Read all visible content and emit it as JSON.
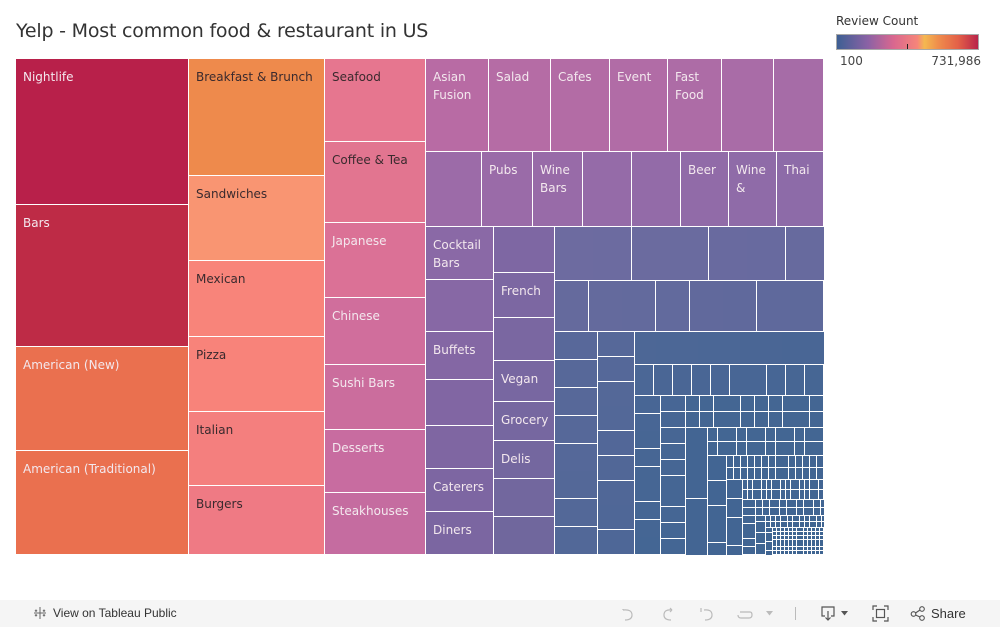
{
  "title": "Yelp - Most common food & restaurant in US",
  "legend": {
    "title": "Review Count",
    "min_label": "100",
    "max_label": "731,986",
    "colors": [
      "#3d5f93",
      "#8b62a5",
      "#d9678f",
      "#f6857a",
      "#f4b850",
      "#ef8c4c",
      "#e36048",
      "#b8244a"
    ]
  },
  "chart_data": {
    "type": "treemap",
    "title": "Yelp - Most common food & restaurant in US",
    "size_measure": "Review Count",
    "color_measure": "Review Count",
    "color_range": [
      100,
      731986
    ],
    "labeled_categories": [
      "Nightlife",
      "Bars",
      "American (New)",
      "American (Traditional)",
      "Breakfast & Brunch",
      "Sandwiches",
      "Mexican",
      "Pizza",
      "Italian",
      "Burgers",
      "Seafood",
      "Coffee & Tea",
      "Japanese",
      "Chinese",
      "Sushi Bars",
      "Desserts",
      "Steakhouses",
      "Asian Fusion",
      "Salad",
      "Cafes",
      "Event",
      "Fast Food",
      "Pubs",
      "Wine Bars",
      "Beer",
      "Wine &",
      "Thai",
      "Cocktail Bars",
      "French",
      "Buffets",
      "Vegan",
      "Grocery",
      "Delis",
      "Caterers",
      "Diners"
    ],
    "tiles": [
      {
        "label": "Nightlife",
        "color": "#b8204a",
        "text": "light",
        "area": [
          0,
          0,
          173,
          146
        ]
      },
      {
        "label": "Bars",
        "color": "#be2b46",
        "text": "light",
        "area": [
          0,
          146,
          173,
          142
        ]
      },
      {
        "label": "American (New)",
        "color": "#ea704f",
        "text": "light",
        "area": [
          0,
          288,
          173,
          104
        ]
      },
      {
        "label": "American (Traditional)",
        "color": "#ea704f",
        "text": "light",
        "area": [
          0,
          392,
          173,
          104
        ]
      },
      {
        "label": "Breakfast & Brunch",
        "color": "#ee8a4c",
        "text": "dark",
        "area": [
          173,
          0,
          136,
          117
        ]
      },
      {
        "label": "Sandwiches",
        "color": "#f99572",
        "text": "dark",
        "area": [
          173,
          117,
          136,
          85
        ]
      },
      {
        "label": "Mexican",
        "color": "#f8847a",
        "text": "dark",
        "area": [
          173,
          202,
          136,
          76
        ]
      },
      {
        "label": "Pizza",
        "color": "#f8837a",
        "text": "dark",
        "area": [
          173,
          278,
          136,
          75
        ]
      },
      {
        "label": "Italian",
        "color": "#f47f7e",
        "text": "dark",
        "area": [
          173,
          353,
          136,
          74
        ]
      },
      {
        "label": "Burgers",
        "color": "#ef7a84",
        "text": "dark",
        "area": [
          173,
          427,
          136,
          69
        ]
      },
      {
        "label": "Seafood",
        "color": "#e6768f",
        "text": "dark",
        "area": [
          309,
          0,
          101,
          83
        ]
      },
      {
        "label": "Coffee & Tea",
        "color": "#e27590",
        "text": "dark",
        "area": [
          309,
          83,
          101,
          81
        ]
      },
      {
        "label": "Japanese",
        "color": "#db7196",
        "text": "light",
        "area": [
          309,
          164,
          101,
          75
        ]
      },
      {
        "label": "Chinese",
        "color": "#d06e9c",
        "text": "light",
        "area": [
          309,
          239,
          101,
          67
        ]
      },
      {
        "label": "Sushi Bars",
        "color": "#cb6d9d",
        "text": "light",
        "area": [
          309,
          306,
          101,
          65
        ]
      },
      {
        "label": "Desserts",
        "color": "#c86ca0",
        "text": "light",
        "area": [
          309,
          371,
          101,
          63
        ]
      },
      {
        "label": "Steakhouses",
        "color": "#c56ca0",
        "text": "light",
        "area": [
          309,
          434,
          101,
          62
        ]
      },
      {
        "label": "Asian Fusion",
        "color": "#b86ba4",
        "text": "light",
        "area": [
          410,
          0,
          63,
          93
        ]
      },
      {
        "label": "Salad",
        "color": "#b56ca5",
        "text": "light",
        "area": [
          473,
          0,
          62,
          93
        ]
      },
      {
        "label": "Cafes",
        "color": "#b36ca5",
        "text": "light",
        "area": [
          535,
          0,
          59,
          93
        ]
      },
      {
        "label": "Event",
        "color": "#b16ca6",
        "text": "light",
        "area": [
          594,
          0,
          58,
          93
        ]
      },
      {
        "label": "Fast Food",
        "color": "#ad6ca6",
        "text": "light",
        "area": [
          652,
          0,
          54,
          93
        ]
      },
      {
        "label": "",
        "color": "#a96ca7",
        "text": "light",
        "area": [
          706,
          0,
          52,
          93
        ]
      },
      {
        "label": "",
        "color": "#a66ca7",
        "text": "light",
        "area": [
          758,
          0,
          50,
          93
        ]
      },
      {
        "label": "",
        "color": "#9c6ba8",
        "text": "light",
        "area": [
          410,
          93,
          56,
          75
        ]
      },
      {
        "label": "Pubs",
        "color": "#9a6ba8",
        "text": "light",
        "area": [
          466,
          93,
          51,
          75
        ]
      },
      {
        "label": "Wine Bars",
        "color": "#986ba8",
        "text": "light",
        "area": [
          517,
          93,
          50,
          75
        ]
      },
      {
        "label": "",
        "color": "#956ba8",
        "text": "light",
        "area": [
          567,
          93,
          49,
          75
        ]
      },
      {
        "label": "",
        "color": "#936ba8",
        "text": "light",
        "area": [
          616,
          93,
          49,
          75
        ]
      },
      {
        "label": "Beer",
        "color": "#916ba8",
        "text": "light",
        "area": [
          665,
          93,
          48,
          75
        ]
      },
      {
        "label": "Wine &",
        "color": "#8f6ba8",
        "text": "light",
        "area": [
          713,
          93,
          48,
          75
        ]
      },
      {
        "label": "Thai",
        "color": "#8d6ba8",
        "text": "light",
        "area": [
          761,
          93,
          47,
          75
        ]
      },
      {
        "label": "Cocktail Bars",
        "color": "#8a69a6",
        "text": "light",
        "area": [
          410,
          168,
          68,
          53
        ]
      },
      {
        "label": "",
        "color": "#8768a5",
        "text": "light",
        "area": [
          410,
          221,
          68,
          52
        ]
      },
      {
        "label": "Buffets",
        "color": "#8467a4",
        "text": "light",
        "area": [
          410,
          273,
          68,
          48
        ]
      },
      {
        "label": "",
        "color": "#8166a3",
        "text": "light",
        "area": [
          410,
          321,
          68,
          46
        ]
      },
      {
        "label": "",
        "color": "#7f66a2",
        "text": "light",
        "area": [
          410,
          367,
          68,
          43
        ]
      },
      {
        "label": "Caterers",
        "color": "#7d66a2",
        "text": "light",
        "area": [
          410,
          410,
          68,
          43
        ]
      },
      {
        "label": "Diners",
        "color": "#7b66a1",
        "text": "light",
        "area": [
          410,
          453,
          68,
          43
        ]
      },
      {
        "label": "",
        "color": "#7e67a3",
        "text": "light",
        "area": [
          478,
          168,
          61,
          46
        ]
      },
      {
        "label": "French",
        "color": "#7c67a2",
        "text": "light",
        "area": [
          478,
          214,
          61,
          45
        ]
      },
      {
        "label": "",
        "color": "#7a67a1",
        "text": "light",
        "area": [
          478,
          259,
          61,
          43
        ]
      },
      {
        "label": "Vegan",
        "color": "#7867a1",
        "text": "light",
        "area": [
          478,
          302,
          61,
          41
        ]
      },
      {
        "label": "Grocery",
        "color": "#7667a0",
        "text": "light",
        "area": [
          478,
          343,
          61,
          39
        ]
      },
      {
        "label": "Delis",
        "color": "#74679f",
        "text": "light",
        "area": [
          478,
          382,
          61,
          38
        ]
      },
      {
        "label": "",
        "color": "#72679e",
        "text": "light",
        "area": [
          478,
          420,
          61,
          38
        ]
      },
      {
        "label": "",
        "color": "#70679d",
        "text": "light",
        "area": [
          478,
          458,
          61,
          38
        ]
      }
    ]
  },
  "footer": {
    "view_on": "View on Tableau Public",
    "share": "Share",
    "icons": [
      "tableau-logo-icon",
      "undo-icon",
      "redo-icon",
      "revert-icon",
      "refresh-icon",
      "pause-dropdown-icon",
      "download-icon",
      "fullscreen-icon",
      "share-icon"
    ]
  }
}
